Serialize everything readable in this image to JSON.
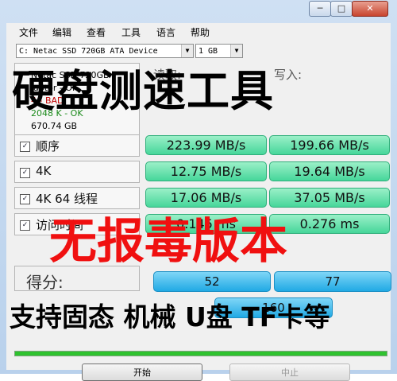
{
  "window": {
    "min_glyph": "─",
    "max_glyph": "□",
    "close_glyph": "✕"
  },
  "menu": [
    "文件",
    "编辑",
    "查看",
    "工具",
    "语言",
    "帮助"
  ],
  "toolbar": {
    "drive": "C: Netac SSD 720GB ATA Device",
    "size": "1 GB"
  },
  "info": {
    "model": "Netac SSD 720GB",
    "driver": "iaStor - OK",
    "status_bad": "4 - BAD",
    "align": "2048 K - OK",
    "capacity": "670.74 GB"
  },
  "columns": {
    "read": "读取:",
    "write": "写入:"
  },
  "tests": [
    {
      "label": "顺序",
      "checked": true,
      "read": "223.99 MB/s",
      "write": "199.66 MB/s"
    },
    {
      "label": "4K",
      "checked": true,
      "read": "12.75 MB/s",
      "write": "19.64 MB/s"
    },
    {
      "label": "4K 64 线程",
      "checked": true,
      "read": "17.06 MB/s",
      "write": "37.05 MB/s"
    },
    {
      "label": "访问时间",
      "checked": true,
      "read": "0.145 ms",
      "write": "0.276 ms"
    }
  ],
  "score": {
    "label": "得分:",
    "read": "52",
    "write": "77",
    "total": "160"
  },
  "progress": 1.0,
  "buttons": {
    "start": "开始",
    "stop": "中止"
  },
  "overlay": {
    "title": "硬盘测速工具",
    "red_banner": "无报毒版本",
    "bottom": "支持固态 机械 U盘 TF卡等"
  },
  "colors": {
    "result_green": "#46d69a",
    "score_blue": "#21a9e4",
    "banner_red": "#f01010"
  }
}
